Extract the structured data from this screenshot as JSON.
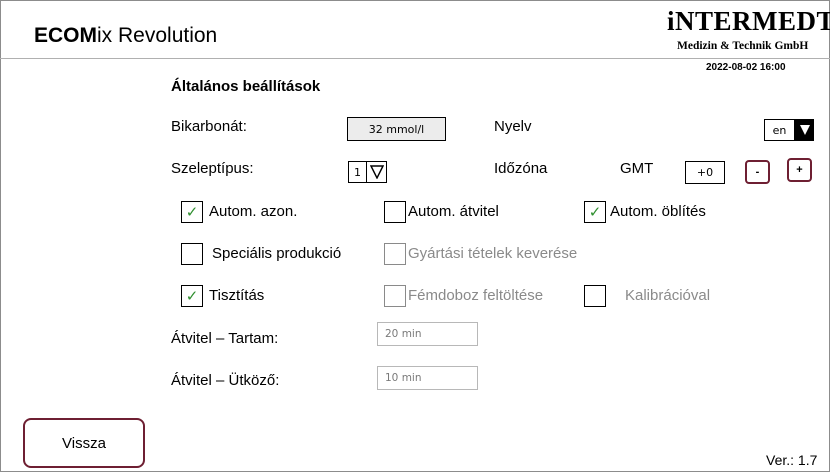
{
  "header": {
    "app_title_bold": "ECOM",
    "app_title_rest": "ix Revolution",
    "logo_main": "iNTERMEDT",
    "logo_sub": "Medizin & Technik GmbH",
    "datetime": "2022-08-02 16:00"
  },
  "section_title": "Általános beállítások",
  "bicarbonate": {
    "label": "Bikarbonát:",
    "value": "32 mmol/l"
  },
  "language": {
    "label": "Nyelv",
    "value": "en"
  },
  "valve_type": {
    "label": "Szeleptípus:",
    "value": "1"
  },
  "timezone": {
    "label": "Időzóna",
    "gmt_label": "GMT",
    "value": "+0",
    "minus_label": "-",
    "plus_label": "+"
  },
  "checkboxes": {
    "auto_id": {
      "label": "Autom. azon.",
      "checked": true,
      "enabled": true
    },
    "auto_transfer": {
      "label": "Autom. átvitel",
      "checked": false,
      "enabled": true
    },
    "auto_rinse": {
      "label": "Autom. öblítés",
      "checked": true,
      "enabled": true
    },
    "special_production": {
      "label": "Speciális produkció",
      "checked": false,
      "enabled": true
    },
    "batch_mixing": {
      "label": "Gyártási tételek keverése",
      "checked": false,
      "enabled": false
    },
    "cleaning": {
      "label": "Tisztítás",
      "checked": true,
      "enabled": true
    },
    "canister_fill": {
      "label": "Fémdoboz feltöltése",
      "checked": false,
      "enabled": false
    },
    "calibration": {
      "label": "Kalibrációval",
      "checked": false,
      "enabled": false
    }
  },
  "transfer_duration": {
    "label": "Átvitel – Tartam:",
    "value": "20 min"
  },
  "transfer_buffer": {
    "label": "Átvitel – Ütköző:",
    "value": "10 min"
  },
  "footer": {
    "back_label": "Vissza",
    "version": "Ver.: 1.7"
  },
  "colors": {
    "accent": "#6e1f32",
    "check": "#2f8f2f",
    "disabled_text": "#8a8a8a"
  }
}
